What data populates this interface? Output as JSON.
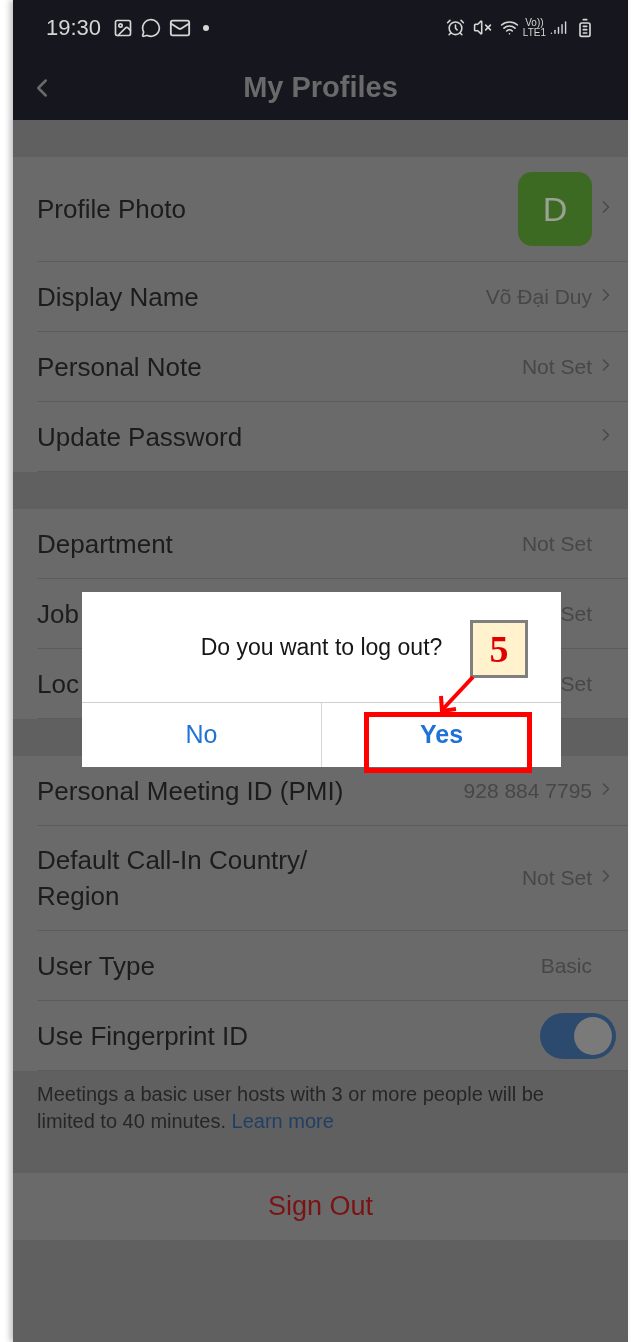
{
  "status_bar": {
    "time": "19:30",
    "network_top": "Vo))",
    "network_bottom": "LTE1"
  },
  "header": {
    "title": "My Profiles"
  },
  "sections": [
    {
      "rows": [
        {
          "kind": "avatar",
          "label": "Profile Photo",
          "avatar_letter": "D",
          "chevron": true
        },
        {
          "kind": "value",
          "label": "Display Name",
          "value": "Võ Đại Duy",
          "chevron": true
        },
        {
          "kind": "value",
          "label": "Personal Note",
          "value": "Not Set",
          "chevron": true
        },
        {
          "kind": "value",
          "label": "Update Password",
          "chevron": true
        }
      ]
    },
    {
      "rows": [
        {
          "kind": "value",
          "label": "Department",
          "value": "Not Set",
          "chevron": false
        },
        {
          "kind": "value",
          "label": "Job",
          "value": "Set",
          "chevron": false
        },
        {
          "kind": "value",
          "label": "Loc",
          "value": "Set",
          "chevron": false
        }
      ]
    },
    {
      "rows": [
        {
          "kind": "value",
          "label": "Personal Meeting ID (PMI)",
          "value": "928 884 7795",
          "chevron": true
        },
        {
          "kind": "value",
          "label": "Default Call-In Country/ Region",
          "value": "Not Set",
          "chevron": true
        },
        {
          "kind": "value",
          "label": "User Type",
          "value": "Basic",
          "chevron": false
        },
        {
          "kind": "toggle",
          "label": "Use Fingerprint ID",
          "on": true
        }
      ]
    }
  ],
  "note": {
    "text": "Meetings a basic user hosts with 3 or more people will be limited to 40 minutes.",
    "link": "Learn more"
  },
  "sign_out": "Sign Out",
  "dialog": {
    "message": "Do you want to log out?",
    "buttons": [
      {
        "label": "No",
        "highlighted": false
      },
      {
        "label": "Yes",
        "highlighted": true
      }
    ]
  },
  "annotation": {
    "step": "5"
  }
}
